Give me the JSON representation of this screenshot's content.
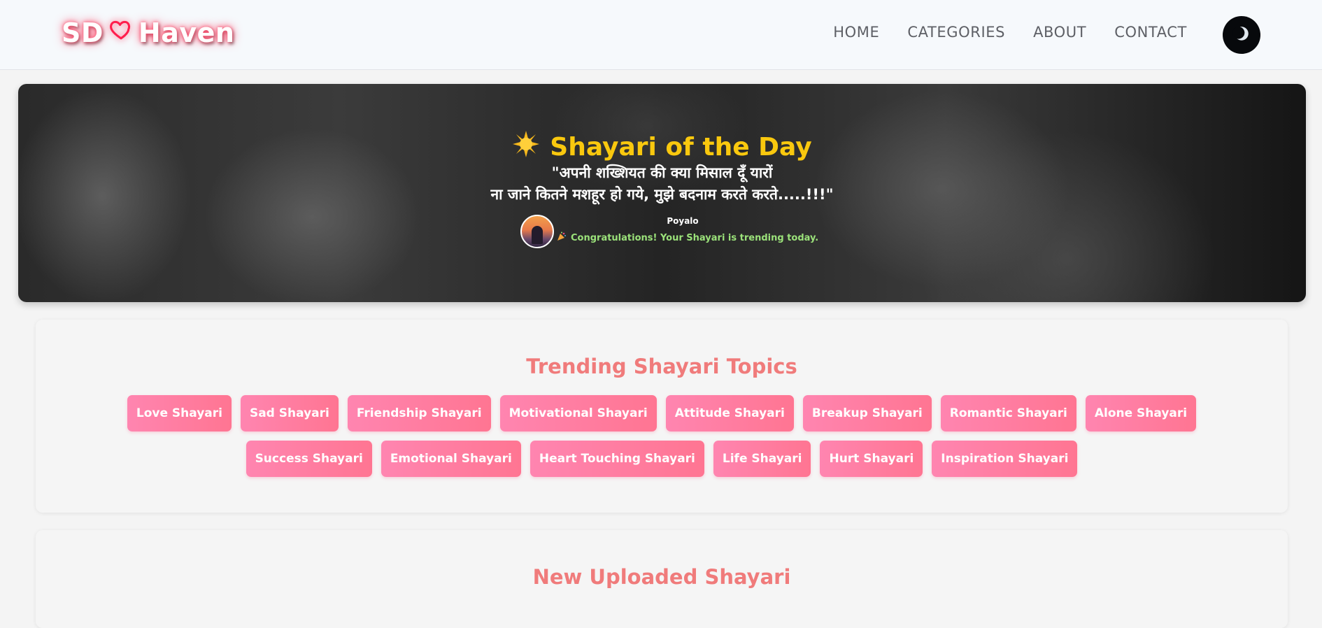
{
  "header": {
    "logo": {
      "left": "SD",
      "right": "Haven"
    },
    "nav": [
      "HOME",
      "CATEGORIES",
      "ABOUT",
      "CONTACT"
    ],
    "theme_toggle_icon": "moon-icon"
  },
  "hero": {
    "title": "Shayari of the Day",
    "title_icon": "sun-icon",
    "quote_line1": "\"अपनी शख्शियत की क्या मिसाल दूँ यारों",
    "quote_line2": "ना जाने कितने मशहूर हो गये, मुझे बदनाम करते करते.....!!!\"",
    "author": "Poyalo",
    "message_icon": "party-popper-icon",
    "message": "Congratulations! Your Shayari is trending today."
  },
  "trending": {
    "title": "Trending Shayari Topics",
    "topics": [
      "Love Shayari",
      "Sad Shayari",
      "Friendship Shayari",
      "Motivational Shayari",
      "Attitude Shayari",
      "Breakup Shayari",
      "Romantic Shayari",
      "Alone Shayari",
      "Success Shayari",
      "Emotional Shayari",
      "Heart Touching Shayari",
      "Life Shayari",
      "Hurt Shayari",
      "Inspiration Shayari"
    ]
  },
  "new_uploads": {
    "title": "New Uploaded Shayari"
  },
  "colors": {
    "accent_yellow": "#f9c80e",
    "tag_pink": "#ff7fa3",
    "section_title": "#f07b7b",
    "congrats_green": "#9be27a"
  }
}
